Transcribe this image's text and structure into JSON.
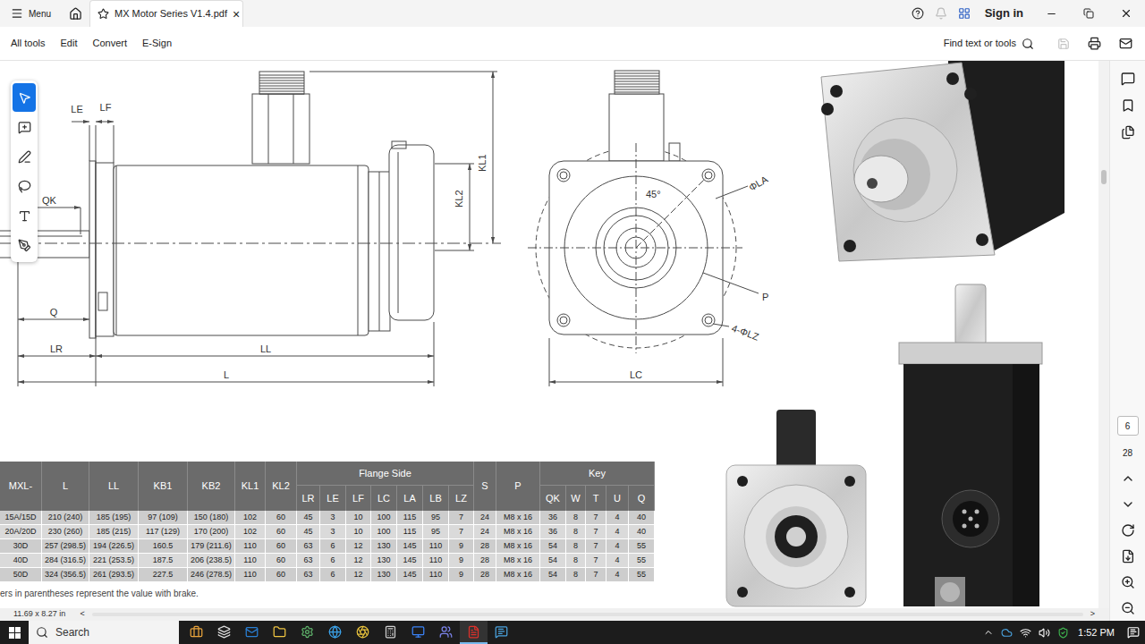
{
  "window": {
    "menu": "Menu",
    "tab_title": "MX Motor Series V1.4.pdf",
    "tab_close": "×",
    "sign_in": "Sign in"
  },
  "toolbar": {
    "items": [
      {
        "label": "All tools"
      },
      {
        "label": "Edit"
      },
      {
        "label": "Convert"
      },
      {
        "label": "E-Sign"
      }
    ],
    "search": "Find text or tools"
  },
  "left_tools": [
    {
      "selected": true
    },
    {
      "selected": false
    },
    {
      "selected": false
    },
    {
      "selected": false
    },
    {
      "selected": false
    },
    {
      "selected": false
    }
  ],
  "vertical_scroll": {
    "level": 0.2
  },
  "page_nav": {
    "current": "6",
    "total": "28"
  },
  "drawing": {
    "side_view": [
      "LE",
      "LF",
      "QK",
      "Q",
      "LR",
      "LL",
      "L",
      "KL2",
      "KL1"
    ],
    "front_view": [
      "45°",
      "ΦLA",
      "P",
      "4-ΦLZ",
      "LC"
    ]
  },
  "table": {
    "header": [
      {
        "label": "MXL-"
      },
      {
        "label": "L"
      },
      {
        "label": "LL"
      },
      {
        "label": "KB1"
      },
      {
        "label": "KB2"
      },
      {
        "label": "KL1"
      },
      {
        "label": "KL2"
      },
      {
        "label": "Flange Side",
        "sub": [
          "LR",
          "LE",
          "LF",
          "LC",
          "LA",
          "LB",
          "LZ"
        ]
      },
      {
        "label": "S"
      },
      {
        "label": "P"
      },
      {
        "label": "Key",
        "sub": [
          "QK",
          "W",
          "T",
          "U",
          "Q"
        ]
      }
    ],
    "rows": [
      [
        "15A/15D",
        "210 (240)",
        "185 (195)",
        "97 (109)",
        "150 (180)",
        "102",
        "60",
        "45",
        "3",
        "10",
        "100",
        "115",
        "95",
        "7",
        "24",
        "M8 x 16",
        "36",
        "8",
        "7",
        "4",
        "40"
      ],
      [
        "20A/20D",
        "230 (260)",
        "185 (215)",
        "117 (129)",
        "170 (200)",
        "102",
        "60",
        "45",
        "3",
        "10",
        "100",
        "115",
        "95",
        "7",
        "24",
        "M8 x 16",
        "36",
        "8",
        "7",
        "4",
        "40"
      ],
      [
        "30D",
        "257 (298.5)",
        "194 (226.5)",
        "160.5",
        "179 (211.6)",
        "110",
        "60",
        "63",
        "6",
        "12",
        "130",
        "145",
        "110",
        "9",
        "28",
        "M8 x 16",
        "54",
        "8",
        "7",
        "4",
        "55"
      ],
      [
        "40D",
        "284 (316.5)",
        "221 (253.5)",
        "187.5",
        "206 (238.5)",
        "110",
        "60",
        "63",
        "6",
        "12",
        "130",
        "145",
        "110",
        "9",
        "28",
        "M8 x 16",
        "54",
        "8",
        "7",
        "4",
        "55"
      ],
      [
        "50D",
        "324 (356.5)",
        "261 (293.5)",
        "227.5",
        "246 (278.5)",
        "110",
        "60",
        "63",
        "6",
        "12",
        "130",
        "145",
        "110",
        "9",
        "28",
        "M8 x 16",
        "54",
        "8",
        "7",
        "4",
        "55"
      ]
    ],
    "footnote": "ers in parentheses represent the value with brake."
  },
  "status_bar": {
    "page_size": "11.69 x 8.27 in",
    "scroll_left": "<",
    "scroll_right": ">"
  },
  "taskbar": {
    "search": "Search",
    "time": "1:52 PM",
    "apps": [
      {
        "selected": false
      },
      {
        "selected": false
      },
      {
        "selected": false
      },
      {
        "selected": false
      },
      {
        "selected": false
      },
      {
        "selected": false
      },
      {
        "selected": false
      },
      {
        "selected": false
      },
      {
        "selected": false
      },
      {
        "selected": false
      },
      {
        "selected": true
      },
      {
        "selected": false
      }
    ]
  }
}
